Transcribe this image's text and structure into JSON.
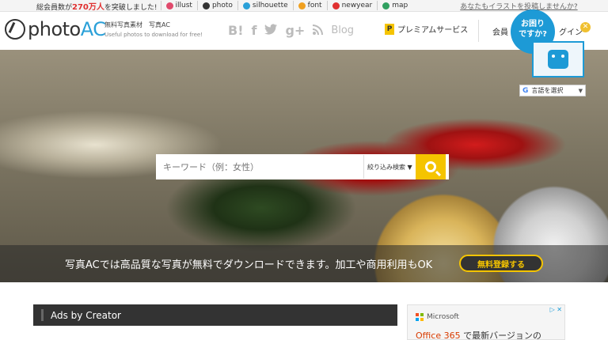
{
  "topbar": {
    "announce_prefix": "総会員数が",
    "announce_number": "270万人",
    "announce_suffix": "を突破しました!",
    "sites": [
      {
        "label": "illust",
        "icon": "illust-icon",
        "color": "#e04a6c"
      },
      {
        "label": "photo",
        "icon": "photo-icon",
        "color": "#333333"
      },
      {
        "label": "silhouette",
        "icon": "silhouette-icon",
        "color": "#2aa0d8"
      },
      {
        "label": "font",
        "icon": "font-icon",
        "color": "#f0a020"
      },
      {
        "label": "newyear",
        "icon": "newyear-icon",
        "color": "#e03030"
      },
      {
        "label": "map",
        "icon": "map-icon",
        "color": "#30a060"
      }
    ],
    "contrib_link": "あなたもイラストを投稿しませんか?"
  },
  "header": {
    "logo_photo": "photo",
    "logo_ac": "AC",
    "tagline_main": "無料写真素材　写真AC",
    "tagline_sub": "Useful photos to download for free!",
    "social": {
      "hatena": "B!",
      "facebook": "f",
      "twitter": "t",
      "gplus": "g+",
      "rss": "≋",
      "blog": "Blog"
    },
    "premium_label": "プレミアムサービス",
    "member_label": "会員",
    "login_label": "グイン",
    "help_text": "お困り\nですか?",
    "accent": "#1d9ad6",
    "brand_yellow": "#f5c400"
  },
  "language": {
    "label": "言語を選択"
  },
  "search": {
    "placeholder": "キーワード（例：女性）",
    "filter_label": "絞り込み検索 ▼"
  },
  "banner": {
    "message": "写真ACでは高品質な写真が無料でダウンロードできます。加工や商用利用もOK",
    "register_label": "無料登録する"
  },
  "ads": {
    "title": "Ads by Creator"
  },
  "microsoft_ad": {
    "brand": "Microsoft",
    "product": "Office 365",
    "headline_rest": " で最新バージョンの",
    "adchoice": "▷ ✕"
  }
}
